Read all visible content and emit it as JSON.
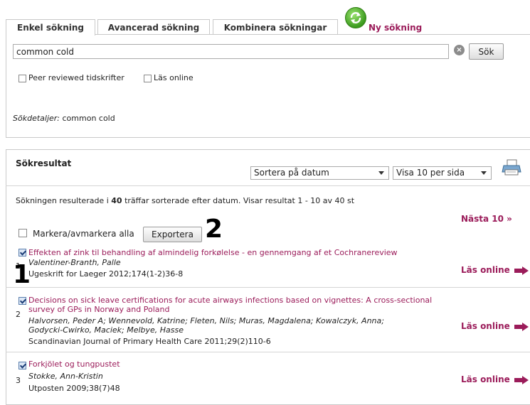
{
  "tabs": [
    {
      "label": "Enkel sökning"
    },
    {
      "label": "Avancerad sökning"
    },
    {
      "label": "Kombinera sökningar"
    }
  ],
  "new_search_label": "Ny sökning",
  "search": {
    "value": "common cold",
    "button_label": "Sök",
    "clear_glyph": "×"
  },
  "filters": {
    "peer_reviewed": "Peer reviewed tidskrifter",
    "read_online": "Läs online"
  },
  "details": {
    "label": "Sökdetaljer:",
    "value": "common cold"
  },
  "results": {
    "title": "Sökresultat",
    "sort_selected": "Sortera på datum",
    "per_page_selected": "Visa 10 per sida",
    "summary_pre": "Sökningen resulterade i ",
    "summary_count": "40",
    "summary_post": " träffar sorterade efter datum. Visar resultat 1 - 10 av 40 st",
    "next_label": "Nästa 10 »",
    "select_all_label": "Markera/avmarkera alla",
    "export_label": "Exportera",
    "read_online_label": "Läs online",
    "items": [
      {
        "number": "1",
        "title": "Effekten af zink til behandling af almindelig forkølelse - en gennemgang af et Cochranereview",
        "authors": "Valentiner-Branth, Palle",
        "source": "Ugeskrift for Laeger 2012;174(1-2)36-8"
      },
      {
        "number": "2",
        "title_line1": "Decisions on sick leave certifications for acute airways infections based on vignettes: A cross-sectional",
        "title_line2": "survey of GPs in Norway and Poland",
        "authors_line1": "Halvorsen, Peder A; Wennevold, Katrine; Fleten, Nils; Muras, Magdalena; Kowalczyk, Anna;",
        "authors_line2": "Godycki-Cwirko, Maciek; Melbye, Hasse",
        "source": "Scandinavian Journal of Primary Health Care 2011;29(2)110-6"
      },
      {
        "number": "3",
        "title": "Forkjölet og tungpustet",
        "authors": "Stokke, Ann-Kristin",
        "source": "Utposten 2009;38(7)48"
      }
    ]
  },
  "annotations": {
    "marker1": "1",
    "marker2": "2"
  }
}
